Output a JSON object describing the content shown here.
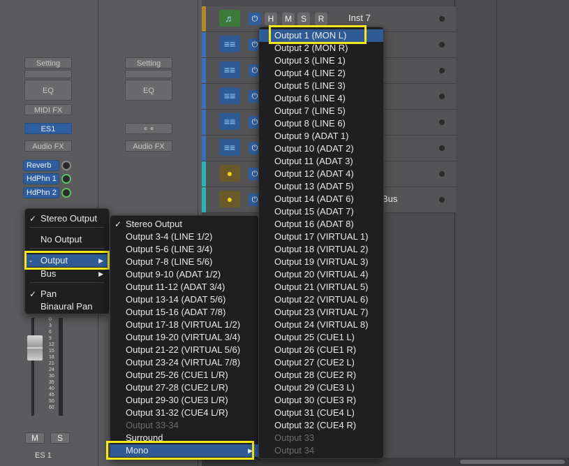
{
  "mixer": {
    "strip1": {
      "setting_label": "Setting",
      "eq_label": "EQ",
      "midi_fx_label": "MIDI FX",
      "instrument_label": "ES1",
      "audio_fx_label": "Audio FX",
      "sends": [
        "Reverb",
        "HdPhn 1",
        "HdPhn 2"
      ],
      "mute_label": "M",
      "solo_label": "S",
      "name": "ES 1",
      "fader_scale": [
        "0",
        "3",
        "6",
        "9",
        "12",
        "15",
        "18",
        "21",
        "24",
        "30",
        "35",
        "40",
        "45",
        "50",
        "60"
      ]
    },
    "strip2": {
      "setting_label": "Setting",
      "eq_label": "EQ",
      "link_icon": "link-icon",
      "audio_fx_label": "Audio FX"
    }
  },
  "tracks": [
    {
      "icon": "software-instrument-icon",
      "name": "Inst 7",
      "color": "#b08a2a"
    },
    {
      "icon": "audio-waveform-icon",
      "name": "",
      "color": "#3a6fc0"
    },
    {
      "icon": "audio-waveform-icon",
      "name": "",
      "color": "#3a6fc0"
    },
    {
      "icon": "audio-waveform-icon",
      "name": "",
      "color": "#3a6fc0"
    },
    {
      "icon": "audio-waveform-icon",
      "name": "",
      "color": "#3a6fc0"
    },
    {
      "icon": "audio-waveform-icon",
      "name": "",
      "color": "#3a6fc0"
    },
    {
      "icon": "aux-knob-icon",
      "name": "",
      "color": "#2bb4b4"
    },
    {
      "icon": "aux-knob-icon",
      "name": "Bus",
      "color": "#2bb4b4"
    }
  ],
  "track_buttons": {
    "power": "⏻",
    "h": "H",
    "m": "M",
    "s": "S",
    "r": "R"
  },
  "output_menu": {
    "items": [
      {
        "label": "Stereo Output",
        "checked": true
      },
      {
        "label": "No Output"
      },
      {
        "label": "Output",
        "marker": "-",
        "submenu": true,
        "highlighted": true
      },
      {
        "label": "Bus",
        "submenu": true
      },
      {
        "label": "Pan",
        "checked": true
      },
      {
        "label": "Binaural Pan"
      }
    ]
  },
  "output_submenu": {
    "items": [
      "Stereo Output",
      "Output 3-4  (LINE 1/2)",
      "Output 5-6  (LINE 3/4)",
      "Output 7-8  (LINE 5/6)",
      "Output 9-10  (ADAT 1/2)",
      "Output 11-12  (ADAT 3/4)",
      "Output 13-14  (ADAT 5/6)",
      "Output 15-16  (ADAT 7/8)",
      "Output 17-18  (VIRTUAL 1/2)",
      "Output 19-20  (VIRTUAL 3/4)",
      "Output 21-22  (VIRTUAL 5/6)",
      "Output 23-24  (VIRTUAL 7/8)",
      "Output 25-26  (CUE1 L/R)",
      "Output 27-28  (CUE2 L/R)",
      "Output 29-30  (CUE3 L/R)",
      "Output 31-32  (CUE4 L/R)",
      "Output 33-34",
      "Surround",
      "Mono"
    ],
    "checked_index": 0,
    "disabled_index": 16,
    "selected_index": 18
  },
  "mono_submenu": {
    "items": [
      "Output 1  (MON L)",
      "Output 2  (MON R)",
      "Output 3  (LINE 1)",
      "Output 4  (LINE 2)",
      "Output 5  (LINE 3)",
      "Output 6  (LINE 4)",
      "Output 7  (LINE 5)",
      "Output 8  (LINE 6)",
      "Output 9  (ADAT 1)",
      "Output 10  (ADAT 2)",
      "Output 11  (ADAT 3)",
      "Output 12  (ADAT 4)",
      "Output 13  (ADAT 5)",
      "Output 14  (ADAT 6)",
      "Output 15  (ADAT 7)",
      "Output 16  (ADAT 8)",
      "Output 17  (VIRTUAL 1)",
      "Output 18  (VIRTUAL 2)",
      "Output 19  (VIRTUAL 3)",
      "Output 20  (VIRTUAL 4)",
      "Output 21  (VIRTUAL 5)",
      "Output 22  (VIRTUAL 6)",
      "Output 23  (VIRTUAL 7)",
      "Output 24  (VIRTUAL 8)",
      "Output 25  (CUE1 L)",
      "Output 26  (CUE1 R)",
      "Output 27  (CUE2 L)",
      "Output 28  (CUE2 R)",
      "Output 29  (CUE3 L)",
      "Output 30  (CUE3 R)",
      "Output 31  (CUE4 L)",
      "Output 32  (CUE4 R)",
      "Output 33",
      "Output 34"
    ],
    "selected_index": 0,
    "disabled_from": 32
  },
  "colors": {
    "highlight": "#f5e81a",
    "selection": "#2e5b94",
    "menu_bg": "#1f1f20"
  }
}
